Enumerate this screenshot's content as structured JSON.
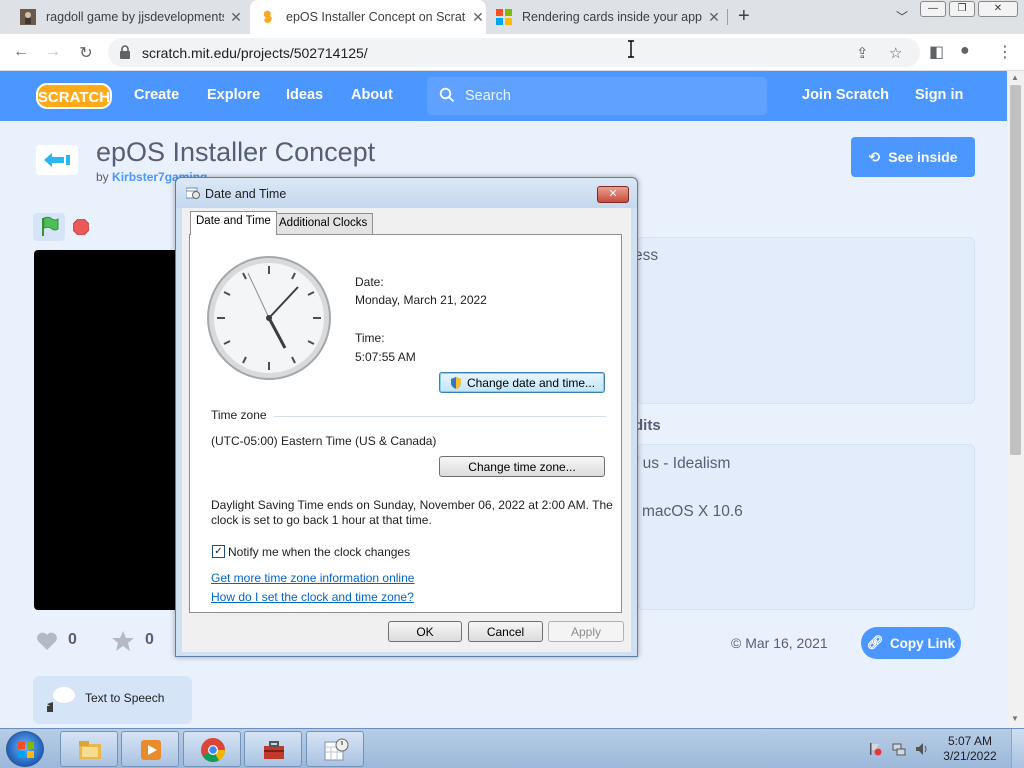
{
  "browser": {
    "tabs": [
      {
        "title": "ragdoll game by jjsdevelopments"
      },
      {
        "title": "epOS Installer Concept on Scratch"
      },
      {
        "title": "Rendering cards inside your app"
      }
    ],
    "url": "scratch.mit.edu/projects/502714125/"
  },
  "scratch": {
    "nav": {
      "create": "Create",
      "explore": "Explore",
      "ideas": "Ideas",
      "about": "About",
      "search_placeholder": "Search",
      "join": "Join Scratch",
      "signin": "Sign in"
    },
    "project": {
      "title": "epOS Installer Concept",
      "by": "by",
      "author": "Kirbster7gaming",
      "see_inside": "See inside",
      "frag_instructions": "ess",
      "frag_credits_heading": "dits",
      "frag_credit1": "f us - Idealism",
      "frag_credit2": "macOS X 10.6",
      "loves": "0",
      "favorites": "0",
      "shared_date": "© Mar 16, 2021",
      "copy_link": "Copy Link",
      "tts": "Text to Speech"
    }
  },
  "dialog": {
    "title": "Date and Time",
    "tabs": [
      "Date and Time",
      "Additional Clocks"
    ],
    "date_label": "Date:",
    "date_value": "Monday, March 21, 2022",
    "time_label": "Time:",
    "time_value": "5:07:55 AM",
    "change_datetime": "Change date and time...",
    "timezone_heading": "Time zone",
    "timezone_value": "(UTC-05:00) Eastern Time (US & Canada)",
    "change_timezone": "Change time zone...",
    "dst_line1": "Daylight Saving Time ends on Sunday, November 06, 2022 at 2:00 AM. The",
    "dst_line2": "clock is set to go back 1 hour at that time.",
    "notify_label": "Notify me when the clock changes",
    "notify_checked": true,
    "link1": "Get more time zone information online",
    "link2": "How do I set the clock and time zone?",
    "ok": "OK",
    "cancel": "Cancel",
    "apply": "Apply"
  },
  "taskbar": {
    "time": "5:07 AM",
    "date": "3/21/2022"
  },
  "colors": {
    "scratch_blue": "#4c97ff",
    "page_bg": "#e9f1fc",
    "link_blue": "#0066cc"
  }
}
